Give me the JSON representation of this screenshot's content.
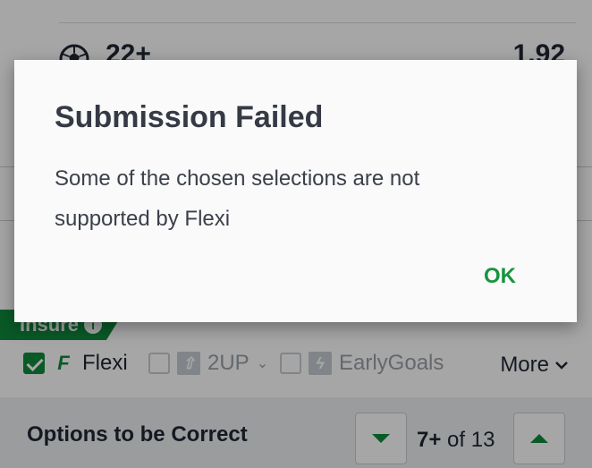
{
  "background": {
    "market_row": {
      "label": "22+",
      "odds": "1.92"
    },
    "insure_label": "Insure",
    "options": [
      {
        "label": "Flexi",
        "checked": true
      },
      {
        "label": "2UP",
        "checked": false
      },
      {
        "label": "EarlyGoals",
        "checked": false
      }
    ],
    "more_label": "More",
    "bottom_bar": {
      "title": "Options to be Correct",
      "count_bold": "7+",
      "count_rest": "of 13"
    }
  },
  "dialog": {
    "title": "Submission Failed",
    "message": "Some of the chosen selections are not supported by Flexi",
    "ok_label": "OK"
  },
  "colors": {
    "accent_green": "#0f8a3c",
    "ok_green": "#17943f",
    "scrim": "rgba(0,0,0,0.35)"
  },
  "icons": [
    "soccer-ball-icon",
    "info-icon",
    "check-icon",
    "flexi-logo-icon",
    "2up-icon",
    "early-goals-icon",
    "chevron-down-icon",
    "arrow-down-icon",
    "arrow-up-icon"
  ]
}
